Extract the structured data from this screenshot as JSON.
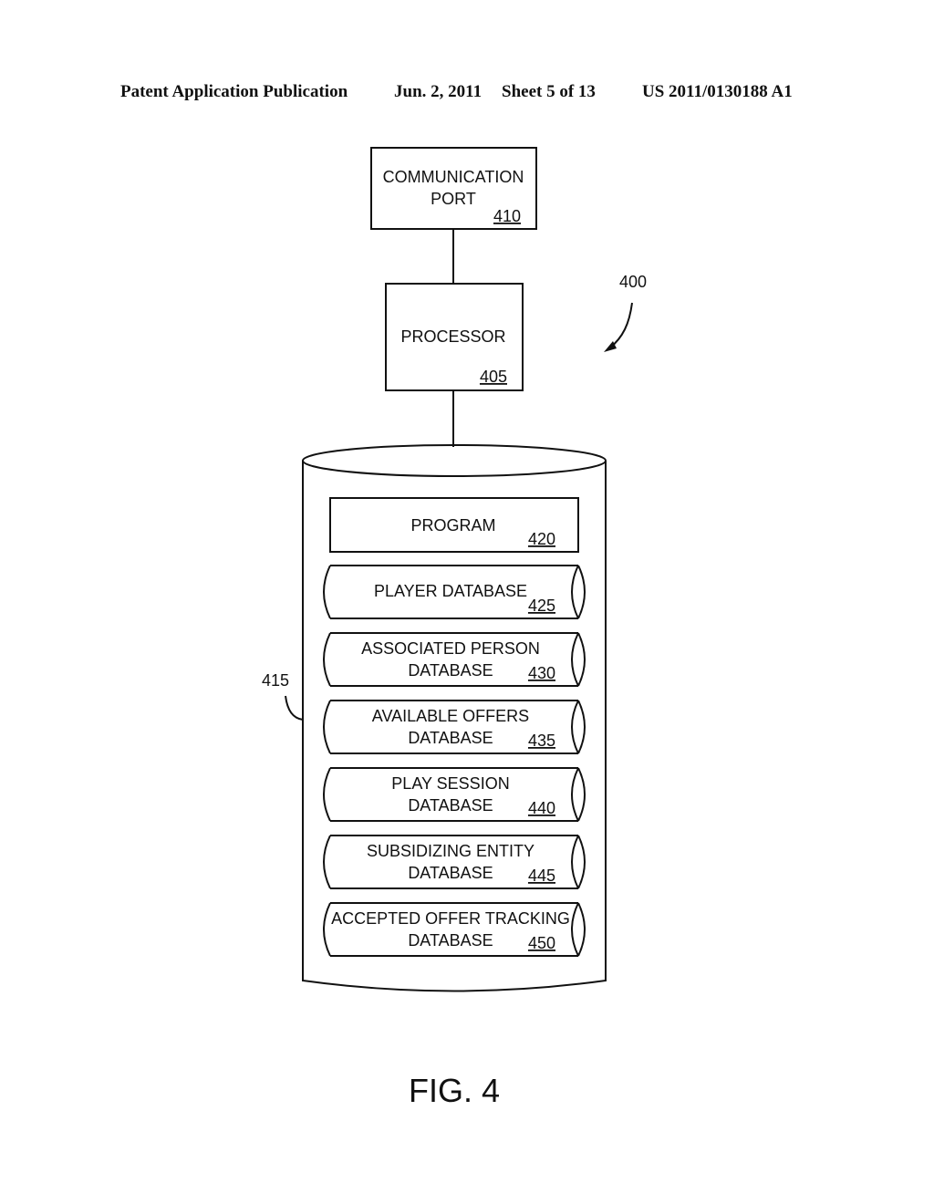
{
  "header": {
    "publication": "Patent Application Publication",
    "date": "Jun. 2, 2011",
    "sheet": "Sheet 5 of 13",
    "number": "US 2011/0130188 A1"
  },
  "diagram": {
    "figure_ref": "400",
    "comm_port": {
      "line1": "COMMUNICATION",
      "line2": "PORT",
      "ref": "410"
    },
    "processor": {
      "label": "PROCESSOR",
      "ref": "405"
    },
    "storage": {
      "ref": "415",
      "program": {
        "label": "PROGRAM",
        "ref": "420"
      },
      "databases": [
        {
          "line1": "PLAYER DATABASE",
          "line2": "",
          "ref": "425"
        },
        {
          "line1": "ASSOCIATED PERSON",
          "line2": "DATABASE",
          "ref": "430"
        },
        {
          "line1": "AVAILABLE OFFERS",
          "line2": "DATABASE",
          "ref": "435"
        },
        {
          "line1": "PLAY SESSION",
          "line2": "DATABASE",
          "ref": "440"
        },
        {
          "line1": "SUBSIDIZING ENTITY",
          "line2": "DATABASE",
          "ref": "445"
        },
        {
          "line1": "ACCEPTED OFFER TRACKING",
          "line2": "DATABASE",
          "ref": "450"
        }
      ]
    },
    "caption": "FIG. 4"
  }
}
